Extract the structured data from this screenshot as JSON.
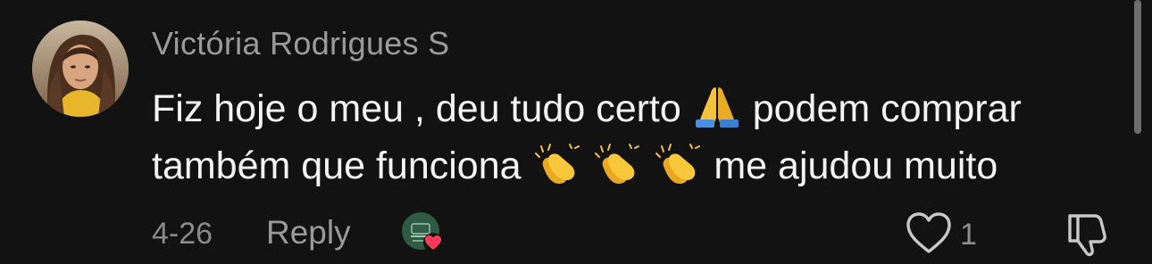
{
  "comment": {
    "author": "Victória Rodrigues S",
    "text_line1_a": "Fiz hoje o meu , deu tudo certo",
    "text_line1_b": "podem comprar",
    "text_line2_a": "também que funciona",
    "text_line2_b": "me ajudou muito",
    "emoji_line1": "folded-hands",
    "emoji_line2": [
      "clapping-hands",
      "clapping-hands",
      "clapping-hands"
    ],
    "date": "4-26",
    "reply_label": "Reply",
    "like_count": "1",
    "creator_liked": true
  },
  "colors": {
    "background": "#121212",
    "author": "#9b9b9b",
    "text": "#f4f4f4",
    "meta": "#8a8a8a",
    "heart_badge": "#ff3b5c"
  }
}
